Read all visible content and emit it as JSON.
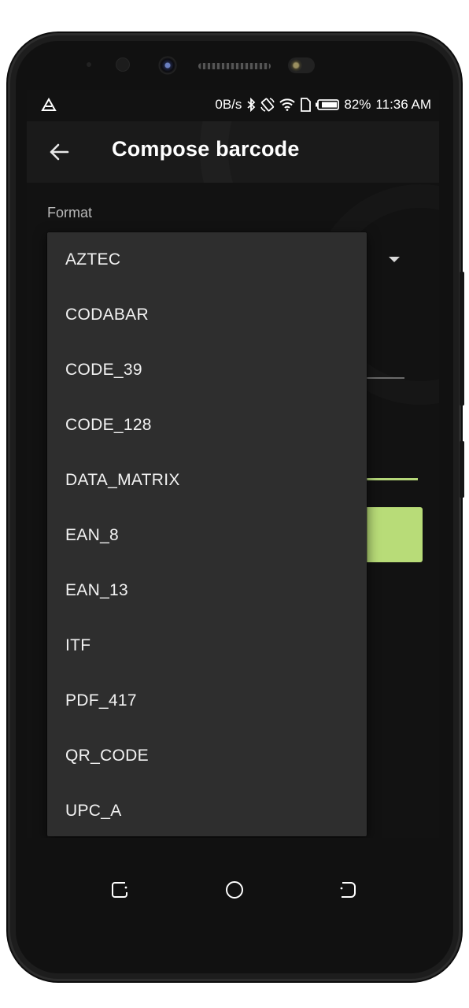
{
  "status_bar": {
    "net_speed": "0B/s",
    "battery": "82%",
    "time": "11:36 AM",
    "icons": [
      "warning-triangle-icon",
      "bluetooth-icon",
      "rotate-icon",
      "wifi-icon",
      "sim-icon",
      "battery-icon"
    ]
  },
  "app_bar": {
    "title": "Compose barcode",
    "back_icon": "arrow-left-icon"
  },
  "form": {
    "format_label": "Format"
  },
  "dropdown": {
    "options": [
      "AZTEC",
      "CODABAR",
      "CODE_39",
      "CODE_128",
      "DATA_MATRIX",
      "EAN_8",
      "EAN_13",
      "ITF",
      "PDF_417",
      "QR_CODE",
      "UPC_A"
    ]
  },
  "colors": {
    "accent": "#b8dc78",
    "menu_background": "#2e2e2e",
    "screen_background": "#121212"
  },
  "nav_bar": {
    "icons": [
      "recents-icon",
      "home-icon",
      "back-icon"
    ]
  }
}
